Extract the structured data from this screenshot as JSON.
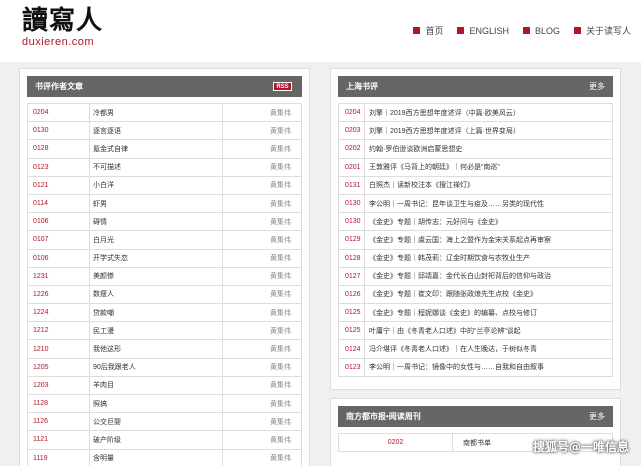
{
  "logo": {
    "cn": "讀寫人",
    "en": "duxieren.com"
  },
  "nav": [
    {
      "label": "首页"
    },
    {
      "label": "ENGLISH"
    },
    {
      "label": "BLOG"
    },
    {
      "label": "关于读写人"
    }
  ],
  "left_panel": {
    "title": "书评作者文章",
    "rss": "RSS",
    "rows": [
      {
        "code": "0204",
        "title": "冷都男",
        "author": "黄集伟"
      },
      {
        "code": "0130",
        "title": "逐言逐语",
        "author": "黄集伟"
      },
      {
        "code": "0128",
        "title": "氪金式自律",
        "author": "黄集伟"
      },
      {
        "code": "0123",
        "title": "不可描述",
        "author": "黄集伟"
      },
      {
        "code": "0121",
        "title": "小白洋",
        "author": "黄集伟"
      },
      {
        "code": "0114",
        "title": "虾男",
        "author": "黄集伟"
      },
      {
        "code": "0106",
        "title": "碍情",
        "author": "黄集伟"
      },
      {
        "code": "0107",
        "title": "白月光",
        "author": "黄集伟"
      },
      {
        "code": "0106",
        "title": "开学式失恋",
        "author": "黄集伟"
      },
      {
        "code": "1231",
        "title": "美颜惨",
        "author": "黄集伟"
      },
      {
        "code": "1226",
        "title": "数瘦人",
        "author": "黄集伟"
      },
      {
        "code": "1224",
        "title": "贷款嘲",
        "author": "黄集伟"
      },
      {
        "code": "1212",
        "title": "民工漫",
        "author": "黄集伟"
      },
      {
        "code": "1210",
        "title": "我他这形",
        "author": "黄集伟"
      },
      {
        "code": "1205",
        "title": "90后我跟老人",
        "author": "黄集伟"
      },
      {
        "code": "1203",
        "title": "羊肉目",
        "author": "黄集伟"
      },
      {
        "code": "1128",
        "title": "照搞",
        "author": "黄集伟"
      },
      {
        "code": "1126",
        "title": "公交巨婴",
        "author": "黄集伟"
      },
      {
        "code": "1121",
        "title": "破产阶级",
        "author": "黄集伟"
      },
      {
        "code": "1119",
        "title": "含明量",
        "author": "黄集伟"
      }
    ]
  },
  "right_panel": {
    "title": "上海书评",
    "more": "更多",
    "rows": [
      {
        "code": "0204",
        "title": "刘擎｜2019西方思想年度述评（中篇·欧美风云）"
      },
      {
        "code": "0203",
        "title": "刘擎｜2019西方思想年度述评（上篇·世界变局）"
      },
      {
        "code": "0202",
        "title": "约翰·罗伯逊谈欧洲启蒙思想史"
      },
      {
        "code": "0201",
        "title": "王敦雅评《马背上的朝廷》｜何必是“南巡”"
      },
      {
        "code": "0131",
        "title": "白照杰｜读新校注本《搜江禅灯》"
      },
      {
        "code": "0130",
        "title": "李公明｜一周书记：昆年谈卫生与疫及……另类的现代性"
      },
      {
        "code": "0130",
        "title": "《金史》专题｜胡传志：元好问与《金史》"
      },
      {
        "code": "0129",
        "title": "《金史》专题｜虞云国：海上之盟作为金宋关系起点再审察"
      },
      {
        "code": "0128",
        "title": "《金史》专题｜韩茂莉：辽金时期饮食与农牧业生产"
      },
      {
        "code": "0127",
        "title": "《金史》专题｜邱靖嘉：金代长白山封祀背后的信仰与政治"
      },
      {
        "code": "0126",
        "title": "《金史》专题｜崔文印：跟随张政烺先生点校《金史》"
      },
      {
        "code": "0125",
        "title": "《金史》专题｜程妮娜谈《金史》的编纂、点校与修订"
      },
      {
        "code": "0125",
        "title": "叶庸宁｜由《冬青老人口述》中的“兰亭论辨”谈起"
      },
      {
        "code": "0124",
        "title": "冯介堪评《冬青老人口述》｜在人生晚达，于树似冬青"
      },
      {
        "code": "0123",
        "title": "李公明｜一周书记：镜像中的女性与……自我和自由叙事"
      }
    ]
  },
  "bottom_panel": {
    "title": "南方都市报•阅读周刊",
    "more": "更多",
    "rows": [
      {
        "code": "0202",
        "title": "南都书单"
      }
    ]
  },
  "watermark": "搜狐号@一唯信息"
}
